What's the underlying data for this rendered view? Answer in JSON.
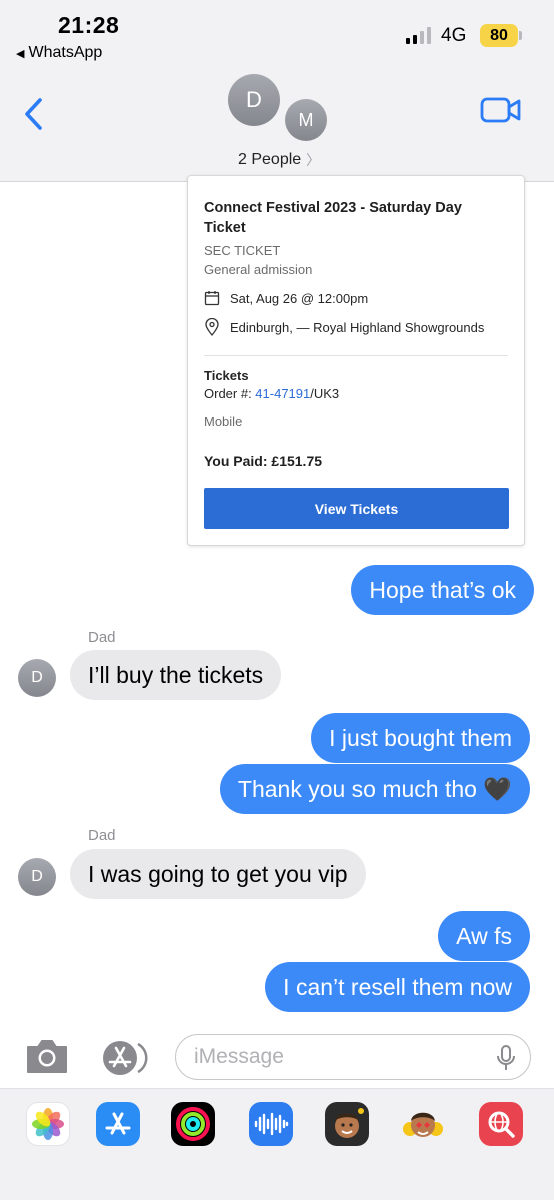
{
  "status": {
    "time": "21:28",
    "back_app": "WhatsApp",
    "network": "4G",
    "battery": "80",
    "battery_color": "#f7d447"
  },
  "header": {
    "avatars": [
      "D",
      "M"
    ],
    "people_label": "2 People",
    "back_icon": "chevron-left-icon",
    "video_icon": "video-camera-icon",
    "accent": "#2b7cf6"
  },
  "ticket": {
    "title": "Connect Festival 2023 - Saturday Day Ticket",
    "section": "SEC TICKET",
    "admission": "General admission",
    "date": "Sat, Aug 26 @ 12:00pm",
    "location": "Edinburgh, — Royal Highland Showgrounds",
    "tickets_label": "Tickets",
    "order_prefix": "Order #: ",
    "order_number": "41-47191",
    "order_suffix": "/UK3",
    "delivery": "Mobile",
    "paid": "You Paid: £151.75",
    "button": "View Tickets",
    "button_color": "#2c6dd5"
  },
  "messages": [
    {
      "from": "me",
      "text": "Hope that’s ok"
    },
    {
      "from": "Dad",
      "sender_label": "Dad",
      "avatar": "D",
      "text": "I’ll buy the tickets"
    },
    {
      "from": "me",
      "text": "I just bought them"
    },
    {
      "from": "me",
      "text": "Thank you so much tho 🖤"
    },
    {
      "from": "Dad",
      "sender_label": "Dad",
      "avatar": "D",
      "text": "I was going to get you vip"
    },
    {
      "from": "me",
      "text": "Aw fs"
    },
    {
      "from": "me",
      "text": "I can’t resell them now"
    }
  ],
  "colors": {
    "outgoing": "#3c8af7",
    "incoming": "#e9e9eb"
  },
  "composer": {
    "placeholder": "iMessage",
    "camera_icon": "camera-icon",
    "apps_icon": "app-store-icon",
    "mic_icon": "microphone-icon"
  },
  "drawer": {
    "apps": [
      "photos-icon",
      "app-store-icon",
      "activity-icon",
      "audio-message-icon",
      "memoji-icon",
      "animoji-icon",
      "search-web-icon"
    ]
  }
}
